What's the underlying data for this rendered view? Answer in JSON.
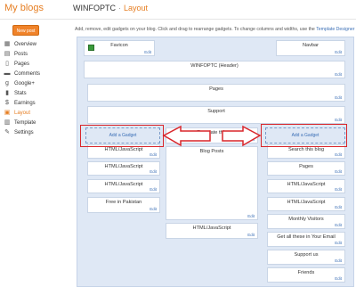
{
  "header": {
    "brand": "My blogs",
    "blog_title": "WINFOPTC",
    "separator": "·",
    "section": "Layout"
  },
  "sidebar": {
    "new_post_label": "New post",
    "items": [
      {
        "label": "Overview",
        "icon": "overview-icon"
      },
      {
        "label": "Posts",
        "icon": "posts-icon"
      },
      {
        "label": "Pages",
        "icon": "pages-icon"
      },
      {
        "label": "Comments",
        "icon": "comments-icon"
      },
      {
        "label": "Google+",
        "icon": "google-plus-icon"
      },
      {
        "label": "Stats",
        "icon": "stats-icon"
      },
      {
        "label": "Earnings",
        "icon": "earnings-icon"
      },
      {
        "label": "Layout",
        "icon": "layout-icon"
      },
      {
        "label": "Template",
        "icon": "template-icon"
      },
      {
        "label": "Settings",
        "icon": "settings-icon"
      }
    ]
  },
  "intro": {
    "text": "Add, remove, edit gadgets on your blog. Click and drag to rearrange gadgets. To change columns and widths, use the",
    "link": "Template Designer"
  },
  "layout": {
    "edit_label": "Edit",
    "add_gadget_label": "Add a Gadget",
    "favicon": "Favicon",
    "navbar": "Navbar",
    "header": "WINFOPTC (Header)",
    "pages": "Pages",
    "support": "Support",
    "translate": "Translate this",
    "blog_posts": "Blog Posts",
    "main_bottom": "HTML/JavaScript",
    "left_column": [
      "HTML/JavaScript",
      "HTML/JavaScript",
      "HTML/JavaScript",
      "Free in Pakistan"
    ],
    "right_column": [
      "Search this blog",
      "Pages",
      "HTML/JavaScript",
      "HTML/JavaScript",
      "Monthly Visitors",
      "Get all these in Your Email",
      "Support us",
      "Friends"
    ]
  },
  "colors": {
    "accent": "#e67e22",
    "highlight": "#d9262b",
    "canvas": "#dfe8f5",
    "link": "#3b6fb6"
  }
}
